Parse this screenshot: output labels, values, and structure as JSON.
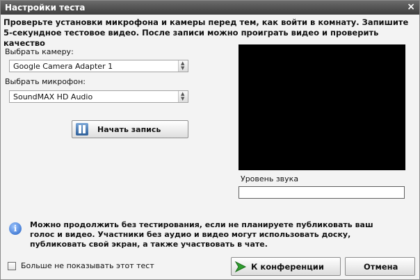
{
  "window": {
    "title": "Настройки теста",
    "close_glyph": "×"
  },
  "instructions": "Проверьте установки микрофона и камеры перед тем, как войти в комнату. Запишите 5-секундное тестовое видео. После записи можно проиграть видео и проверить качество",
  "camera": {
    "label": "Выбрать камеру:",
    "selected": "Google Camera Adapter 1"
  },
  "microphone": {
    "label": "Выбрать микрофон:",
    "selected": "SoundMAX HD Audio"
  },
  "record_button": {
    "label": "Начать запись",
    "icon": "pause-icon"
  },
  "sound_level": {
    "label": "Уровень звука"
  },
  "info": {
    "icon": "info-icon",
    "text": "Можно продолжить без тестирования, если не планируете публиковать ваш голос и видео. Участники без аудио и видео могут использовать доску, публиковать свой экран, а также участвовать в чате."
  },
  "dont_show": {
    "label": "Больше не показывать этот тест",
    "checked": false
  },
  "buttons": {
    "conference": "К конференции",
    "cancel": "Отмена"
  },
  "colors": {
    "titlebar": "#4a4a4a",
    "preview": "#000000",
    "accent_green": "#2f9e2f"
  }
}
